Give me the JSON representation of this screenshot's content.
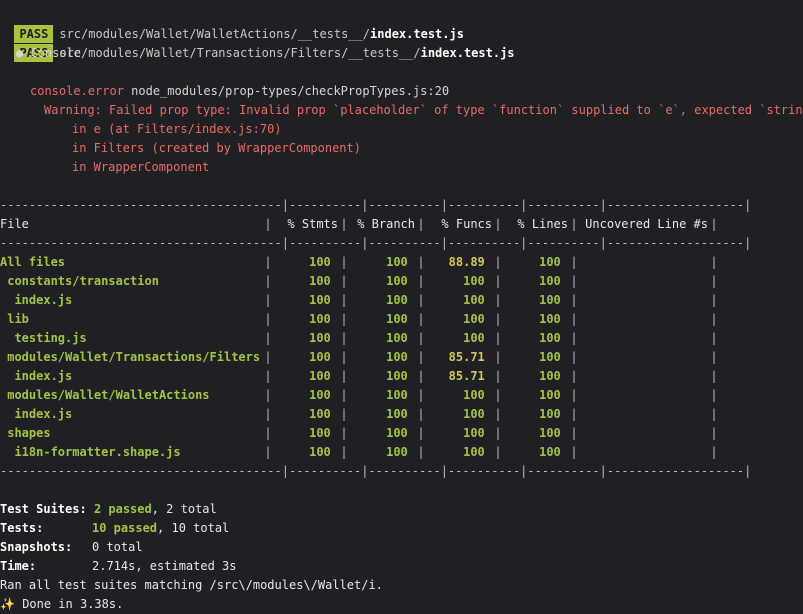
{
  "pass_lines": [
    {
      "badge": "PASS",
      "dir": "src/modules/Wallet/WalletActions/__tests__/",
      "file": "index.test.js"
    },
    {
      "badge": "PASS",
      "dir": "src/modules/Wallet/Transactions/Filters/__tests__/",
      "file": "index.test.js"
    }
  ],
  "console_label": "● Console",
  "console_error": {
    "prefix": "console.error",
    "location": "node_modules/prop-types/checkPropTypes.js:20",
    "warning": "Warning: Failed prop type: Invalid prop `placeholder` of type `function` supplied to `e`, expected `string`.",
    "stack": [
      "in e (at Filters/index.js:70)",
      "in Filters (created by WrapperComponent)",
      "in WrapperComponent"
    ]
  },
  "coverage": {
    "separator_top": "---------------------------------------|----------|----------|----------|----------|-------------------|",
    "headers": [
      "File",
      "% Stmts",
      "% Branch",
      "% Funcs",
      "% Lines",
      "Uncovered Line #s"
    ],
    "separator_mid": "---------------------------------------|----------|----------|----------|----------|-------------------|",
    "rows": [
      {
        "file": "All files",
        "stmts": "100",
        "branch": "100",
        "funcs": "88.89",
        "lines": "100",
        "uncovered": "",
        "indent": 0,
        "funcs_color": "yellow"
      },
      {
        "file": "constants/transaction",
        "stmts": "100",
        "branch": "100",
        "funcs": "100",
        "lines": "100",
        "uncovered": "",
        "indent": 1,
        "funcs_color": "green"
      },
      {
        "file": "index.js",
        "stmts": "100",
        "branch": "100",
        "funcs": "100",
        "lines": "100",
        "uncovered": "",
        "indent": 2,
        "funcs_color": "green"
      },
      {
        "file": "lib",
        "stmts": "100",
        "branch": "100",
        "funcs": "100",
        "lines": "100",
        "uncovered": "",
        "indent": 1,
        "funcs_color": "green"
      },
      {
        "file": "testing.js",
        "stmts": "100",
        "branch": "100",
        "funcs": "100",
        "lines": "100",
        "uncovered": "",
        "indent": 2,
        "funcs_color": "green"
      },
      {
        "file": "modules/Wallet/Transactions/Filters",
        "stmts": "100",
        "branch": "100",
        "funcs": "85.71",
        "lines": "100",
        "uncovered": "",
        "indent": 1,
        "funcs_color": "yellow"
      },
      {
        "file": "index.js",
        "stmts": "100",
        "branch": "100",
        "funcs": "85.71",
        "lines": "100",
        "uncovered": "",
        "indent": 2,
        "funcs_color": "yellow"
      },
      {
        "file": "modules/Wallet/WalletActions",
        "stmts": "100",
        "branch": "100",
        "funcs": "100",
        "lines": "100",
        "uncovered": "",
        "indent": 1,
        "funcs_color": "green"
      },
      {
        "file": "index.js",
        "stmts": "100",
        "branch": "100",
        "funcs": "100",
        "lines": "100",
        "uncovered": "",
        "indent": 2,
        "funcs_color": "green"
      },
      {
        "file": "shapes",
        "stmts": "100",
        "branch": "100",
        "funcs": "100",
        "lines": "100",
        "uncovered": "",
        "indent": 1,
        "funcs_color": "green"
      },
      {
        "file": "i18n-formatter.shape.js",
        "stmts": "100",
        "branch": "100",
        "funcs": "100",
        "lines": "100",
        "uncovered": "",
        "indent": 2,
        "funcs_color": "green"
      }
    ],
    "separator_bottom": "---------------------------------------|----------|----------|----------|----------|-------------------|"
  },
  "summary": {
    "suites_label": "Test Suites:",
    "suites_passed": "2 passed",
    "suites_total": ", 2 total",
    "tests_label": "Tests:",
    "tests_passed": "10 passed",
    "tests_total": ", 10 total",
    "snapshots_label": "Snapshots:",
    "snapshots_value": "0 total",
    "time_label": "Time:",
    "time_value": "2.714s, estimated 3s",
    "ran_line": "Ran all test suites matching /src\\/modules\\/Wallet/i.",
    "done_icon": "✨",
    "done_text": "Done in 3.38s."
  },
  "colors": {
    "background": "#1f2023",
    "pass_badge": "#a9c23f",
    "error": "#ec6a6a",
    "success": "#a9c23f",
    "warning": "#d7c94c"
  }
}
